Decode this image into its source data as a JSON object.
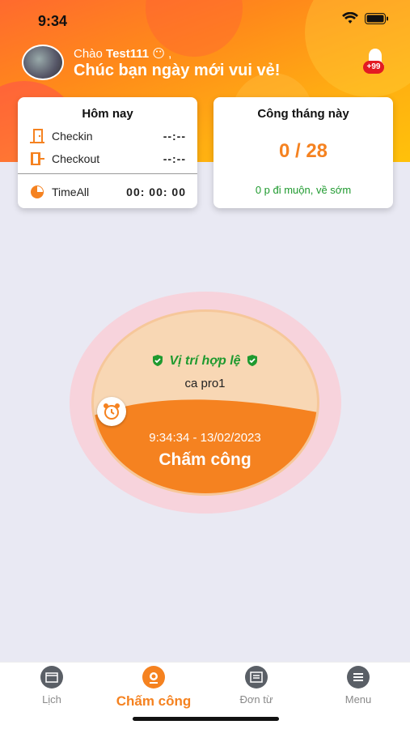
{
  "status": {
    "time": "9:34"
  },
  "header": {
    "greeting_prefix": "Chào",
    "username": "Test111",
    "greeting_suffix": "😶 ,",
    "subtitle": "Chúc bạn ngày mới vui vẻ!",
    "notifications_badge": "+99"
  },
  "today_card": {
    "title": "Hôm nay",
    "checkin_label": "Checkin",
    "checkin_value": "--:--",
    "checkout_label": "Checkout",
    "checkout_value": "--:--",
    "timeall_label": "TimeAll",
    "timeall_value": "00: 00: 00"
  },
  "month_card": {
    "title": "Công tháng này",
    "value": "0 / 28",
    "late_text": "0 p đi muộn, về sớm"
  },
  "checkin_panel": {
    "location_status": "Vị trí hợp lệ",
    "shift_name": "ca pro1",
    "datetime": "9:34:34 - 13/02/2023",
    "action_label": "Chấm công"
  },
  "tabs": [
    {
      "label": "Lịch",
      "icon": "calendar-icon",
      "active": false
    },
    {
      "label": "Chấm công",
      "icon": "fingerprint-icon",
      "active": true
    },
    {
      "label": "Đơn từ",
      "icon": "document-icon",
      "active": false
    },
    {
      "label": "Menu",
      "icon": "menu-icon",
      "active": false
    }
  ],
  "colors": {
    "accent": "#f58220",
    "success": "#1f9a2f",
    "badge": "#e31b23"
  }
}
